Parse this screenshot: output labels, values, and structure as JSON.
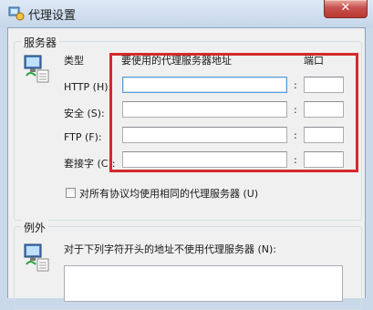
{
  "window": {
    "title": "代理设置",
    "close_glyph": "✕"
  },
  "servers": {
    "legend": "服务器",
    "col_type": "类型",
    "col_address": "要使用的代理服务器地址",
    "col_port": "端口",
    "rows": [
      {
        "label": "HTTP (H):",
        "address": "",
        "port": ""
      },
      {
        "label": "安全 (S):",
        "address": "",
        "port": ""
      },
      {
        "label": "FTP (F):",
        "address": "",
        "port": ""
      },
      {
        "label": "套接字 (C):",
        "address": "",
        "port": ""
      }
    ],
    "colon": ":",
    "same_proxy_label": "对所有协议均使用相同的代理服务器 (U)",
    "same_proxy_checked": false
  },
  "exceptions": {
    "legend": "例外",
    "label": "对于下列字符开头的地址不使用代理服务器 (N):"
  },
  "highlight_color": "#d42a2a"
}
